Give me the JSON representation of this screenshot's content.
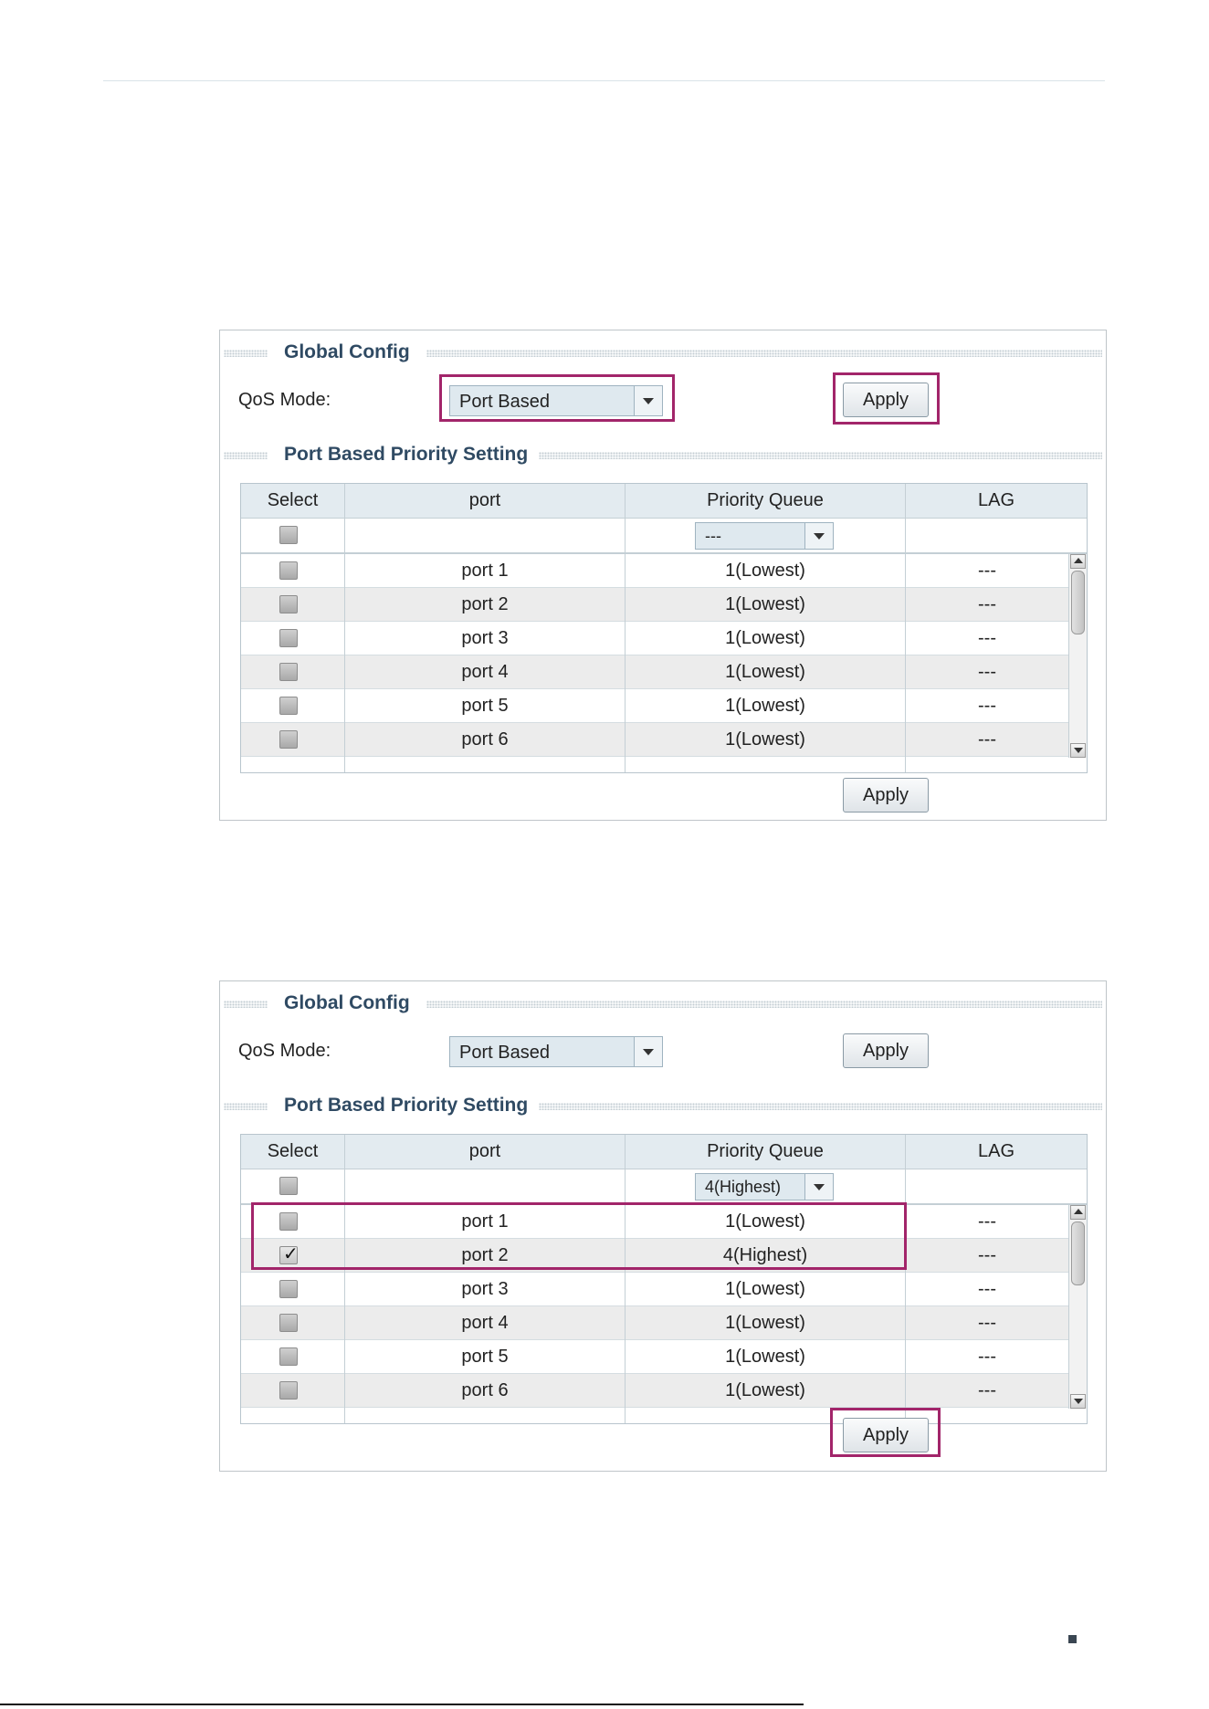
{
  "screenshots": [
    {
      "global_config": {
        "heading": "Global Config",
        "qos_label": "QoS Mode:",
        "qos_value": "Port Based",
        "apply_label": "Apply"
      },
      "port_section": {
        "heading": "Port Based Priority Setting",
        "columns": [
          "Select",
          "port",
          "Priority Queue",
          "LAG"
        ],
        "filter_priority": "---",
        "rows": [
          {
            "port": "port 1",
            "priority": "1(Lowest)",
            "lag": "---",
            "checked": false
          },
          {
            "port": "port 2",
            "priority": "1(Lowest)",
            "lag": "---",
            "checked": false
          },
          {
            "port": "port 3",
            "priority": "1(Lowest)",
            "lag": "---",
            "checked": false
          },
          {
            "port": "port 4",
            "priority": "1(Lowest)",
            "lag": "---",
            "checked": false
          },
          {
            "port": "port 5",
            "priority": "1(Lowest)",
            "lag": "---",
            "checked": false
          },
          {
            "port": "port 6",
            "priority": "1(Lowest)",
            "lag": "---",
            "checked": false
          }
        ],
        "apply_label": "Apply"
      }
    },
    {
      "global_config": {
        "heading": "Global Config",
        "qos_label": "QoS Mode:",
        "qos_value": "Port Based",
        "apply_label": "Apply"
      },
      "port_section": {
        "heading": "Port Based Priority Setting",
        "columns": [
          "Select",
          "port",
          "Priority Queue",
          "LAG"
        ],
        "filter_priority": "4(Highest)",
        "rows": [
          {
            "port": "port 1",
            "priority": "1(Lowest)",
            "lag": "---",
            "checked": false
          },
          {
            "port": "port 2",
            "priority": "4(Highest)",
            "lag": "---",
            "checked": true
          },
          {
            "port": "port 3",
            "priority": "1(Lowest)",
            "lag": "---",
            "checked": false
          },
          {
            "port": "port 4",
            "priority": "1(Lowest)",
            "lag": "---",
            "checked": false
          },
          {
            "port": "port 5",
            "priority": "1(Lowest)",
            "lag": "---",
            "checked": false
          },
          {
            "port": "port 6",
            "priority": "1(Lowest)",
            "lag": "---",
            "checked": false
          }
        ],
        "apply_label": "Apply"
      }
    }
  ],
  "colors": {
    "highlight": "#a2256a",
    "heading": "#2f4a63",
    "header_bg": "#e3ebf0"
  }
}
